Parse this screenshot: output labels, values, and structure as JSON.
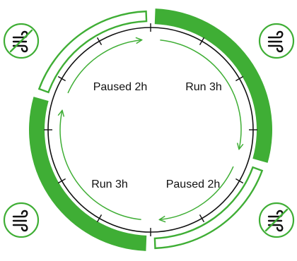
{
  "colors": {
    "accent": "#3fae35",
    "ring": "#111111",
    "background": "#ffffff"
  },
  "cycle": {
    "segments": [
      {
        "label": "Paused 2h",
        "state": "paused",
        "hours": 2,
        "fan_icon": "fan-off-icon"
      },
      {
        "label": "Run 3h",
        "state": "run",
        "hours": 3,
        "fan_icon": "fan-on-icon"
      },
      {
        "label": "Paused 2h",
        "state": "paused",
        "hours": 2,
        "fan_icon": "fan-off-icon"
      },
      {
        "label": "Run 3h",
        "state": "run",
        "hours": 3,
        "fan_icon": "fan-on-icon"
      }
    ]
  }
}
